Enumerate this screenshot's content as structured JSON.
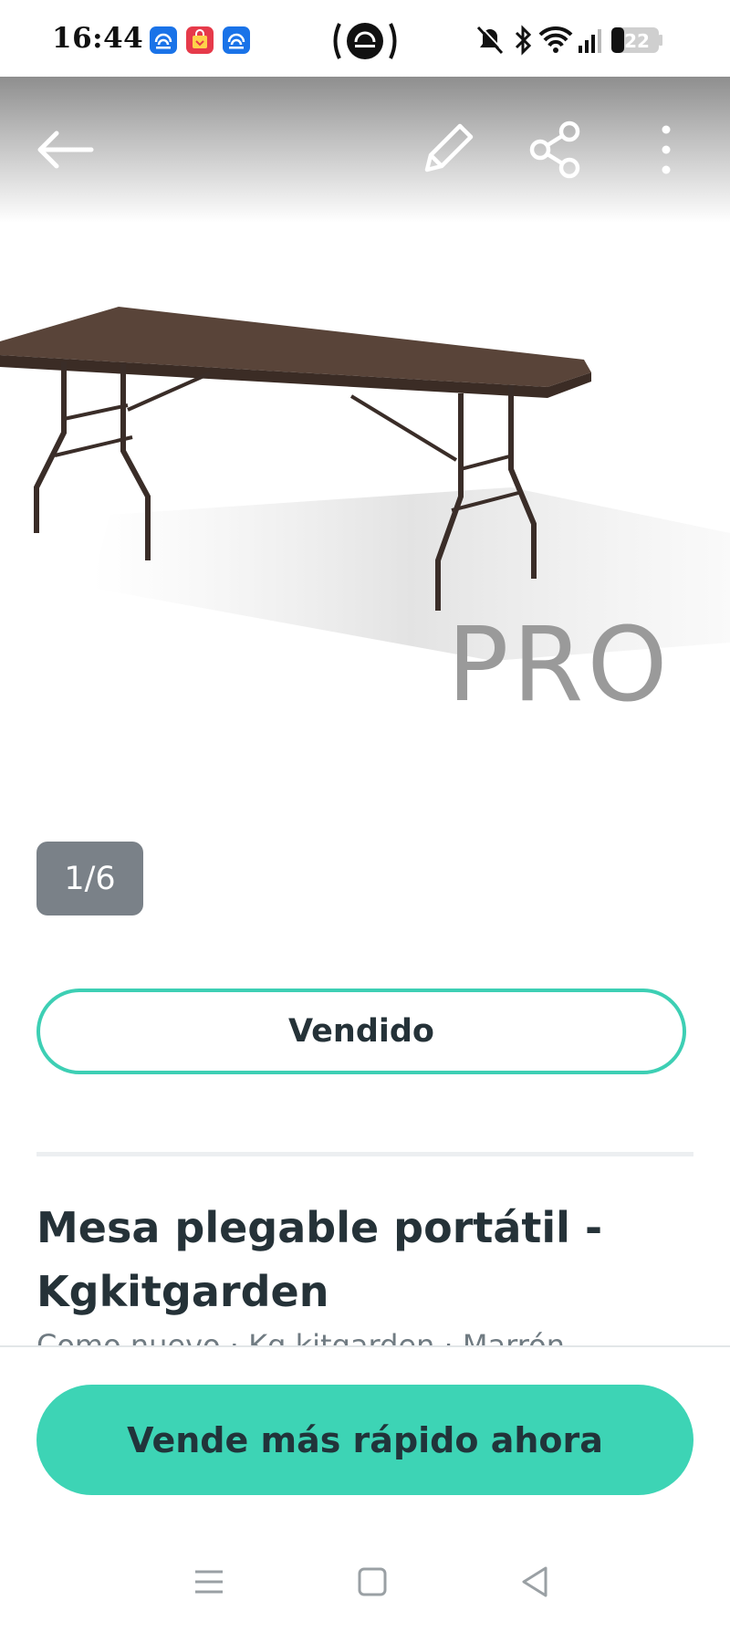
{
  "status_bar": {
    "time": "16:44",
    "battery": "22",
    "app_icons": [
      "wifi-app-icon",
      "shopping-bag-icon",
      "wifi-app-icon"
    ],
    "system_icons": [
      "hotspot-icon",
      "bell-muted-icon",
      "bluetooth-icon",
      "wifi-icon",
      "signal-icon",
      "battery-icon"
    ]
  },
  "toolbar": {
    "back_icon": "arrow-left-icon",
    "edit_icon": "pencil-icon",
    "share_icon": "share-icon",
    "more_icon": "more-vertical-icon"
  },
  "gallery": {
    "watermark": "PRO",
    "counter": "1/6"
  },
  "listing": {
    "status_label": "Vendido",
    "title": "Mesa plegable portátil - Kgkitgarden",
    "subtitle": "Como nuevo · Kg kitgarden · Marrón"
  },
  "cta": {
    "label": "Vende más rápido ahora",
    "color": "#3dd4b5"
  },
  "accent_color": "#3dcfb4",
  "nav": {
    "icons": [
      "menu-icon",
      "home-square-icon",
      "back-triangle-icon"
    ]
  }
}
